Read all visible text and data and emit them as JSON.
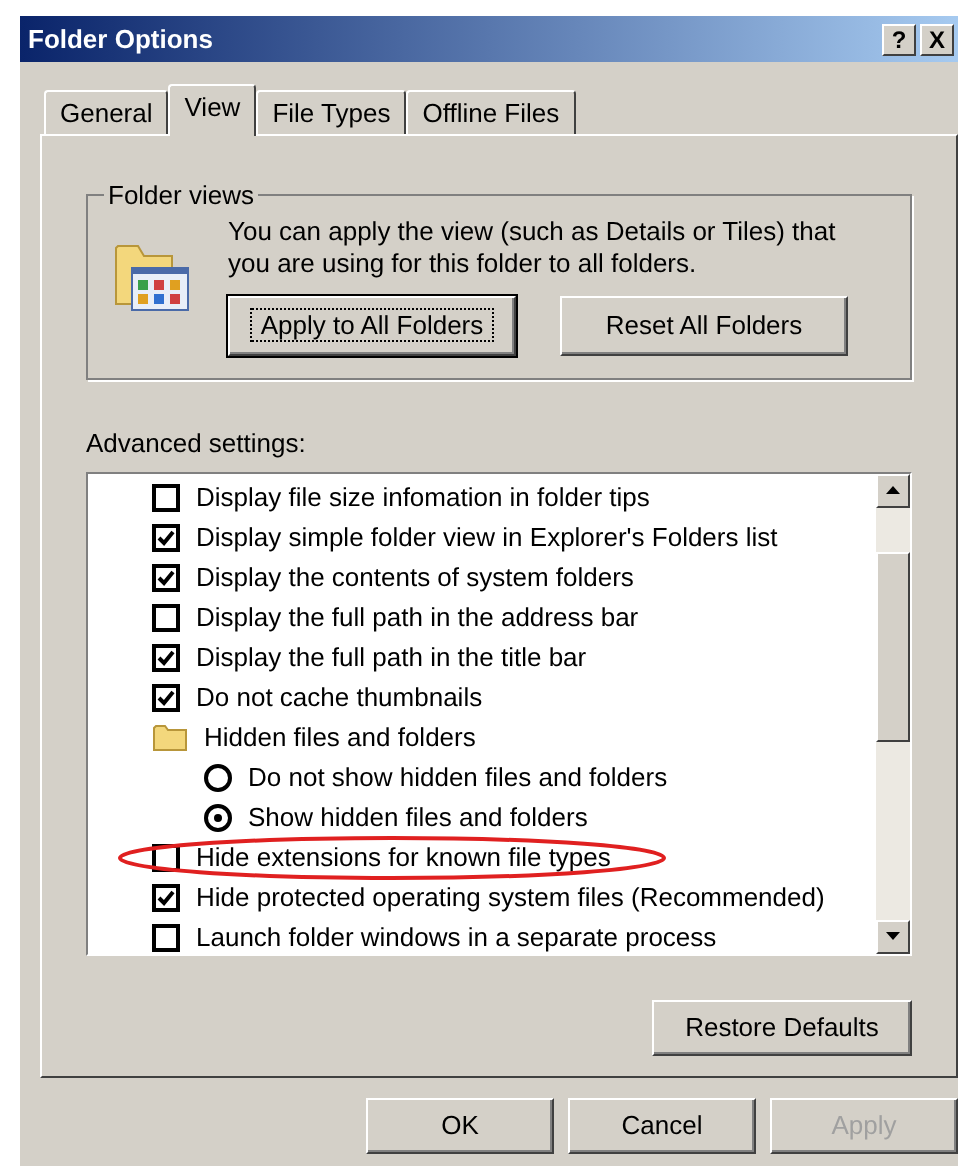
{
  "window": {
    "title": "Folder Options",
    "help_button": "?",
    "close_button": "X"
  },
  "tabs": [
    {
      "label": "General",
      "selected": false
    },
    {
      "label": "View",
      "selected": true
    },
    {
      "label": "File Types",
      "selected": false
    },
    {
      "label": "Offline Files",
      "selected": false
    }
  ],
  "folder_views": {
    "legend": "Folder views",
    "description": "You can apply the view (such as Details or Tiles) that you are using for this folder to all folders.",
    "buttons": [
      {
        "label": "Apply to All Folders",
        "focused": true
      },
      {
        "label": "Reset All Folders",
        "focused": false
      }
    ]
  },
  "advanced": {
    "label": "Advanced settings:",
    "items": [
      {
        "kind": "checkbox",
        "label": "Display file size infomation in folder tips",
        "checked": false
      },
      {
        "kind": "checkbox",
        "label": "Display simple folder view in Explorer's Folders list",
        "checked": true
      },
      {
        "kind": "checkbox",
        "label": "Display the contents of system folders",
        "checked": true
      },
      {
        "kind": "checkbox",
        "label": "Display the full path in the address bar",
        "checked": false
      },
      {
        "kind": "checkbox",
        "label": "Display the full path in the title bar",
        "checked": true
      },
      {
        "kind": "checkbox",
        "label": "Do not cache thumbnails",
        "checked": true
      },
      {
        "kind": "folder",
        "label": "Hidden files and folders",
        "children": [
          {
            "kind": "radio",
            "label": "Do not show hidden files and folders",
            "selected": false
          },
          {
            "kind": "radio",
            "label": "Show hidden files and folders",
            "selected": true
          }
        ]
      },
      {
        "kind": "checkbox",
        "label": "Hide extensions for known file types",
        "checked": false,
        "circled": true
      },
      {
        "kind": "checkbox",
        "label": "Hide protected operating system files (Recommended)",
        "checked": true
      },
      {
        "kind": "checkbox",
        "label": "Launch folder windows in a separate process",
        "checked": false
      }
    ],
    "restore_button": "Restore Defaults"
  },
  "footer_buttons": [
    {
      "label": "OK",
      "disabled": false
    },
    {
      "label": "Cancel",
      "disabled": false
    },
    {
      "label": "Apply",
      "disabled": true
    }
  ]
}
